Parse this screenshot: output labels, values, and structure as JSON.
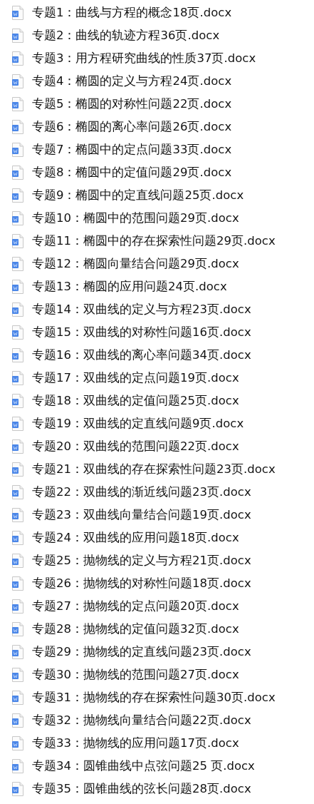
{
  "files": [
    "专题1：曲线与方程的概念18页.docx",
    "专题2：曲线的轨迹方程36页.docx",
    "专题3：用方程研究曲线的性质37页.docx",
    "专题4：椭圆的定义与方程24页.docx",
    "专题5：椭圆的对称性问题22页.docx",
    "专题6：椭圆的离心率问题26页.docx",
    "专题7：椭圆中的定点问题33页.docx",
    "专题8：椭圆中的定值问题29页.docx",
    "专题9：椭圆中的定直线问题25页.docx",
    "专题10：椭圆中的范围问题29页.docx",
    "专题11：椭圆中的存在探索性问题29页.docx",
    "专题12：椭圆向量结合问题29页.docx",
    "专题13：椭圆的应用问题24页.docx",
    "专题14：双曲线的定义与方程23页.docx",
    "专题15：双曲线的对称性问题16页.docx",
    "专题16：双曲线的离心率问题34页.docx",
    "专题17：双曲线的定点问题19页.docx",
    "专题18：双曲线的定值问题25页.docx",
    "专题19：双曲线的定直线问题9页.docx",
    "专题20：双曲线的范围问题22页.docx",
    "专题21：双曲线的存在探索性问题23页.docx",
    "专题22：双曲线的渐近线问题23页.docx",
    "专题23：双曲线向量结合问题19页.docx",
    "专题24：双曲线的应用问题18页.docx",
    "专题25：抛物线的定义与方程21页.docx",
    "专题26：抛物线的对称性问题18页.docx",
    "专题27：抛物线的定点问题20页.docx",
    "专题28：抛物线的定值问题32页.docx",
    "专题29：抛物线的定直线问题23页.docx",
    "专题30：抛物线的范围问题27页.docx",
    "专题31：抛物线的存在探索性问题30页.docx",
    "专题32：抛物线向量结合问题22页.docx",
    "专题33：抛物线的应用问题17页.docx",
    "专题34：圆锥曲线中点弦问题25 页.docx",
    "专题35：圆锥曲线的弦长问题28页.docx"
  ]
}
